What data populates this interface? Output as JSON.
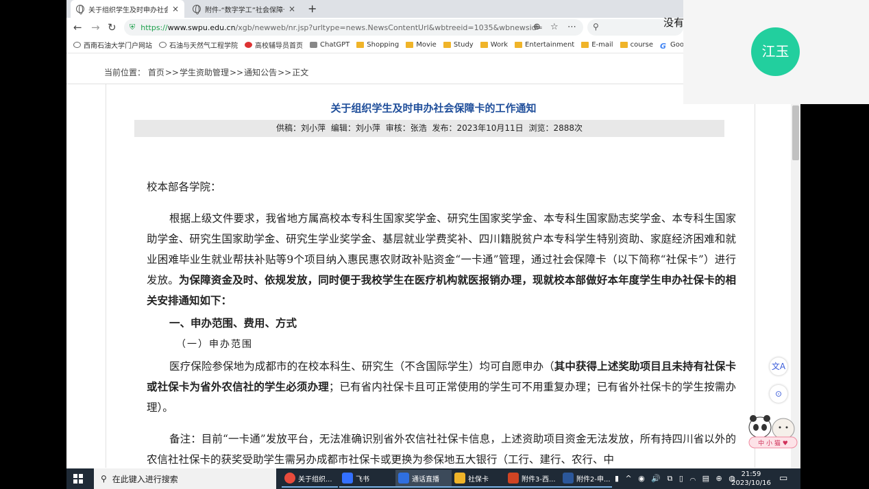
{
  "tabs": [
    {
      "title": "关于组织学生及时申办社会保",
      "close": "×"
    },
    {
      "title": "附件-“数字学工”社会保障卡",
      "close": "×"
    }
  ],
  "new_tab": "+",
  "nav": {
    "back": "←",
    "forward": "→",
    "reload": "↻"
  },
  "url": {
    "scheme": "https://",
    "host": "www.swpu.edu.cn",
    "path": "/xgb/newweb/nr.jsp?urltype=news.NewsContentUrl&wbtreeid=1035&wbnewsid="
  },
  "bookmarks": [
    {
      "label": "西南石油大学门户网站",
      "icon": "globe-icon"
    },
    {
      "label": "石油与天然气工程学院",
      "icon": "globe-icon"
    },
    {
      "label": "高校辅导员首页",
      "icon": "red-icon"
    },
    {
      "label": "ChatGPT",
      "icon": "chatgpt-icon"
    },
    {
      "label": "Shopping",
      "icon": "folder-icon"
    },
    {
      "label": "Movie",
      "icon": "folder-icon"
    },
    {
      "label": "Study",
      "icon": "folder-icon"
    },
    {
      "label": "Work",
      "icon": "folder-icon"
    },
    {
      "label": "Entertainment",
      "icon": "folder-icon"
    },
    {
      "label": "E-mail",
      "icon": "folder-icon"
    },
    {
      "label": "course",
      "icon": "folder-icon"
    },
    {
      "label": "Google",
      "icon": "google-icon"
    }
  ],
  "breadcrumb": {
    "label": "当前位置：",
    "items": [
      "首页",
      "学生资助管理",
      "通知公告",
      "正文"
    ],
    "sep": ">>"
  },
  "article": {
    "title": "关于组织学生及时申办社会保障卡的工作通知",
    "meta": {
      "author": "供稿：刘小萍",
      "editor": "编辑：刘小萍",
      "reviewer": "审核：张浩",
      "published": "发布：2023年10月11日",
      "views": "浏览：2888次"
    },
    "salutation": "校本部各学院：",
    "p1a": "根据上级文件要求，我省地方属高校本专科生国家奖学金、研究生国家奖学金、本专科生国家励志奖学金、本专科生国家助学金、研究生国家助学金、研究生学业奖学金、基层就业学费奖补、四川籍脱贫户本专科学生特别资助、家庭经济困难和就业困难毕业生就业帮扶补贴等9个项目纳入惠民惠农财政补贴资金“一卡通”管理，通过社会保障卡（以下简称“社保卡”）进行发放。",
    "p1b": "为保障资金及时、依规发放，同时便于我校学生在医疗机构就医报销办理，现就校本部做好本年度学生申办社保卡的相关安排通知如下：",
    "h1": "一、申办范围、费用、方式",
    "h2": "（一）申办范围",
    "p2a": "医疗保险参保地为成都市的在校本科生、研究生（不含国际学生）均可自愿申办（",
    "p2b": "其中获得上述奖助项目且未持有社保卡或社保卡为省外农信社的学生必须办理",
    "p2c": "；已有省内社保卡且可正常使用的学生可不用重复办理；已有省外社保卡的学生按需办理）。",
    "p3": "备注：目前“一卡通”发放平台，无法准确识别省外农信社社保卡信息，上述资助项目资金无法发放，所有持四川省以外的农信社社保卡的获奖受助学生需另办成都市社保卡或更换为参保地五大银行（工行、建行、农行、中"
  },
  "side_buttons": {
    "translate": "文A",
    "assistant": "⊙"
  },
  "mascot_text": "中 小 猫 ♥",
  "overlay": {
    "avatar": "江玉",
    "no_label": "没有"
  },
  "taskbar": {
    "search": "在此键入进行搜索",
    "tasks": [
      {
        "label": "关于组织...",
        "color": "#e94b3c"
      },
      {
        "label": "飞书",
        "color": "#3370ff"
      },
      {
        "label": "通话直播",
        "color": "#2f6fe0"
      },
      {
        "label": "社保卡",
        "color": "#f0b429"
      },
      {
        "label": "附件3-西...",
        "color": "#d04423"
      },
      {
        "label": "附件2-申...",
        "color": "#2b579a"
      }
    ],
    "tray": "▮ ^ ◉ 🔊 ⧉ ▯ ⌒ ▤ ⊕ ◍",
    "time": "21:59",
    "date": "2023/10/16"
  }
}
